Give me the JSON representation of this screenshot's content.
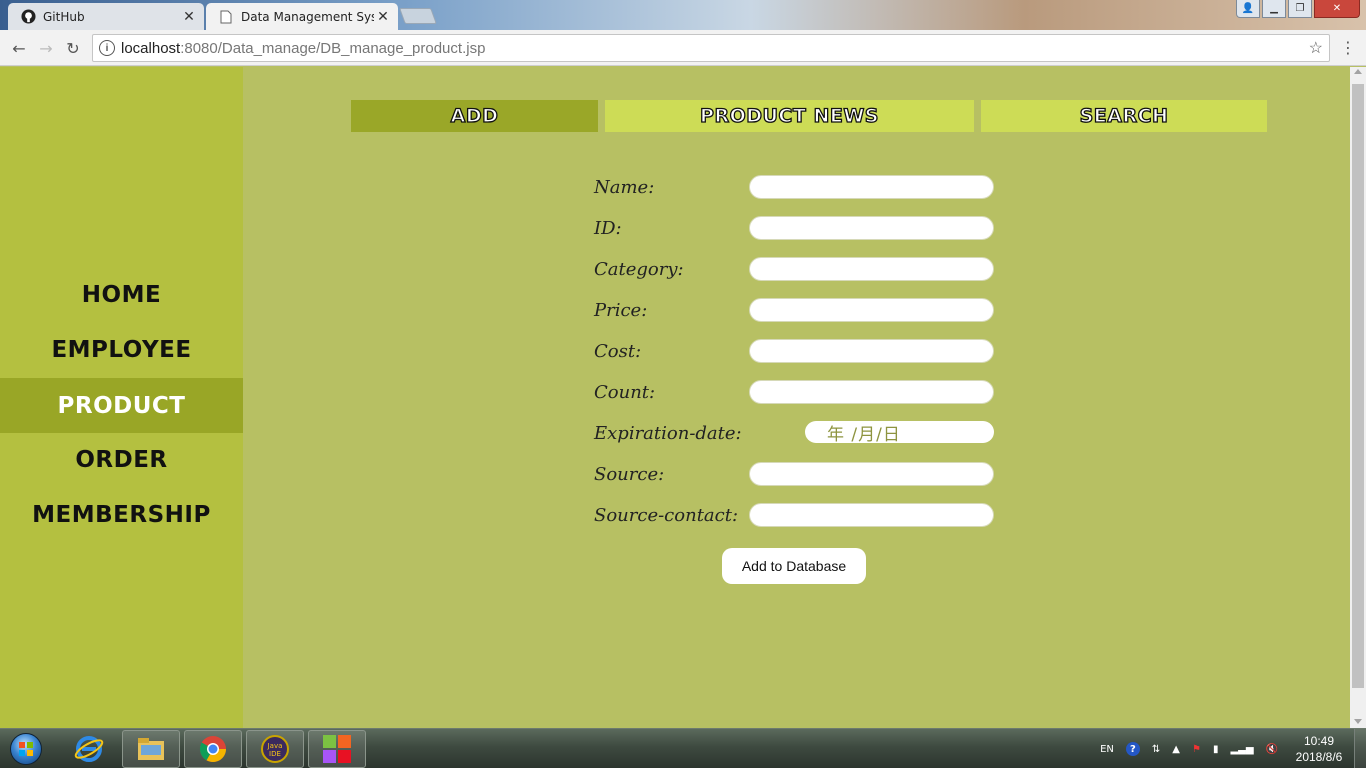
{
  "browser": {
    "tabs": [
      {
        "title": "GitHub",
        "active": false
      },
      {
        "title": "Data Management Syst",
        "active": true
      }
    ],
    "url_host": "localhost",
    "url_rest": ":8080/Data_manage/DB_manage_product.jsp"
  },
  "sidebar": {
    "items": [
      {
        "label": "HOME",
        "active": false
      },
      {
        "label": "EMPLOYEE",
        "active": false
      },
      {
        "label": "PRODUCT",
        "active": true
      },
      {
        "label": "ORDER",
        "active": false
      },
      {
        "label": "MEMBERSHIP",
        "active": false
      }
    ]
  },
  "topnav": {
    "add": "ADD",
    "news": "PRODUCT NEWS",
    "search": "SEARCH"
  },
  "form": {
    "fields": [
      {
        "label": "Name:",
        "value": ""
      },
      {
        "label": "ID:",
        "value": ""
      },
      {
        "label": "Category:",
        "value": ""
      },
      {
        "label": "Price:",
        "value": ""
      },
      {
        "label": "Cost:",
        "value": ""
      },
      {
        "label": "Count:",
        "value": ""
      },
      {
        "label": "Expiration-date:",
        "value": "年 /月/日"
      },
      {
        "label": "Source:",
        "value": ""
      },
      {
        "label": "Source-contact:",
        "value": ""
      }
    ],
    "submit_label": "Add to Database"
  },
  "taskbar": {
    "tray_lang": "EN",
    "time": "10:49",
    "date": "2018/8/6"
  },
  "colors": {
    "sidebar_bg": "#b4c040",
    "sidebar_active": "#99a626",
    "content_bg": "#b7c063",
    "topnav_active": "#9aa728",
    "topnav_inactive": "#cddc56"
  }
}
